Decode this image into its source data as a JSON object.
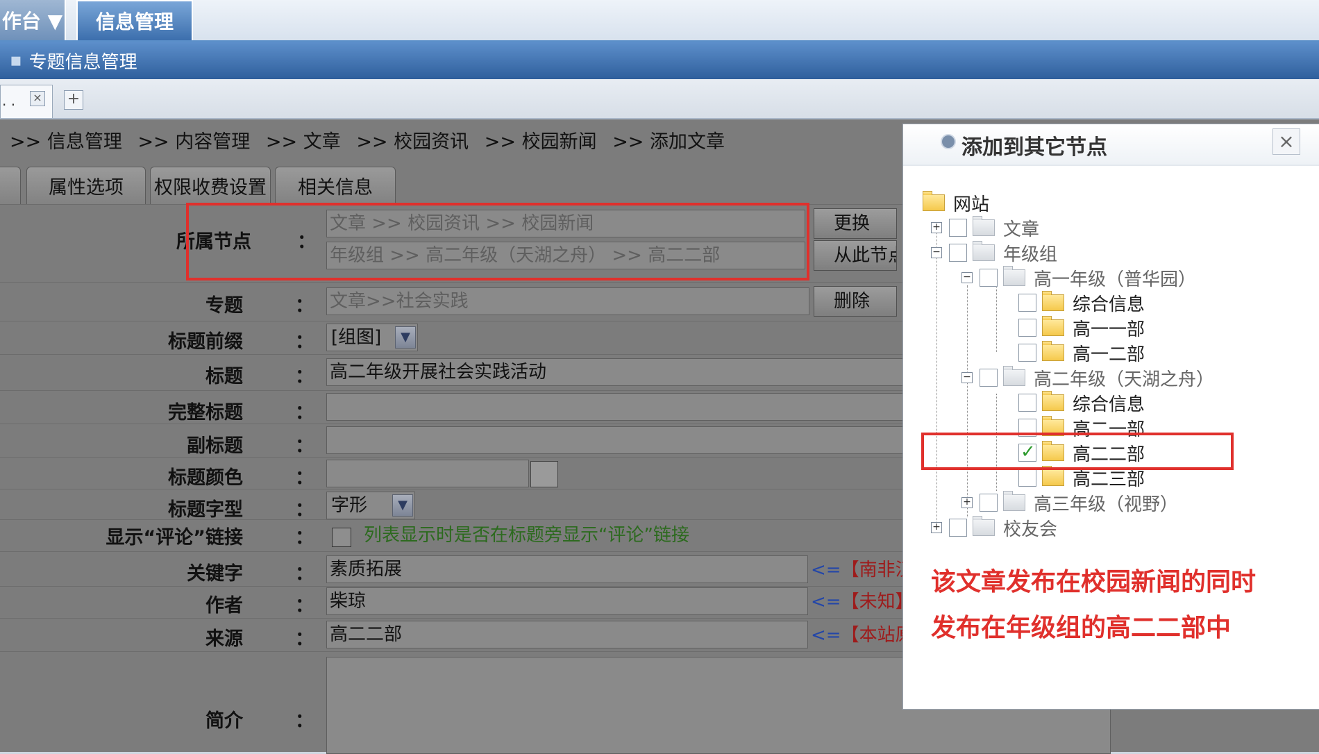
{
  "top_tabs": {
    "workbench": "作台 ▼",
    "info_manage": "信息管理"
  },
  "header": {
    "sep": "▪",
    "title": "专题信息管理"
  },
  "page_tabs": {
    "current": ". .",
    "close": "×",
    "new": "+"
  },
  "breadcrumb": [
    ">> 信息管理",
    ">> 内容管理",
    ">> 文章",
    ">> 校园资讯",
    ">> 校园新闻",
    ">> 添加文章"
  ],
  "form_tabs": [
    "属性选项",
    "权限收费设置",
    "相关信息"
  ],
  "form": {
    "colon": "：",
    "node_label": "所属节点",
    "node_value_1": "文章 >> 校园资讯 >> 校园新闻",
    "node_value_2": "年级组 >> 高二年级（天湖之舟） >> 高二二部",
    "btn_change": "更换",
    "btn_from_node": "从此节点",
    "topic_label": "专题",
    "topic_value": "文章>>社会实践",
    "btn_delete": "删除",
    "prefix_label": "标题前缀",
    "prefix_value": "[组图]",
    "title_label": "标题",
    "title_value": "高二年级开展社会实践活动",
    "full_title_label": "完整标题",
    "full_title_value": "",
    "subtitle_label": "副标题",
    "subtitle_value": "",
    "title_color_label": "标题颜色",
    "title_font_label": "标题字型",
    "title_font_value": "字形",
    "comment_label": "显示“评论”链接",
    "comment_text": "列表显示时是否在标题旁显示“评论”链接",
    "keyword_label": "关键字",
    "keyword_value": "素质拓展",
    "keyword_hint_arrow": "<=",
    "keyword_hint": "【南非汉",
    "author_label": "作者",
    "author_value": "柴琼",
    "author_hint": "【未知】",
    "source_label": "来源",
    "source_value": "高二二部",
    "source_hint": "【本站原",
    "intro_label": "简介"
  },
  "popup": {
    "title": "添加到其它节点",
    "close": "×",
    "tree": {
      "root": "网站",
      "article": "文章",
      "grade_group": "年级组",
      "grade1": "高一年级（普华园）",
      "g1_items": [
        "综合信息",
        "高一一部",
        "高一二部"
      ],
      "grade2": "高二年级（天湖之舟）",
      "g2_items": [
        "综合信息",
        "高二一部",
        "高二二部",
        "高二三部"
      ],
      "grade3": "高三年级（视野）",
      "alumni": "校友会"
    },
    "annotation_line1": "该文章发布在校园新闻的同时",
    "annotation_line2": "发布在年级组的高二二部中"
  },
  "colors": {
    "accent_red": "#e0302c",
    "header_blue": "#2f5f9c"
  }
}
